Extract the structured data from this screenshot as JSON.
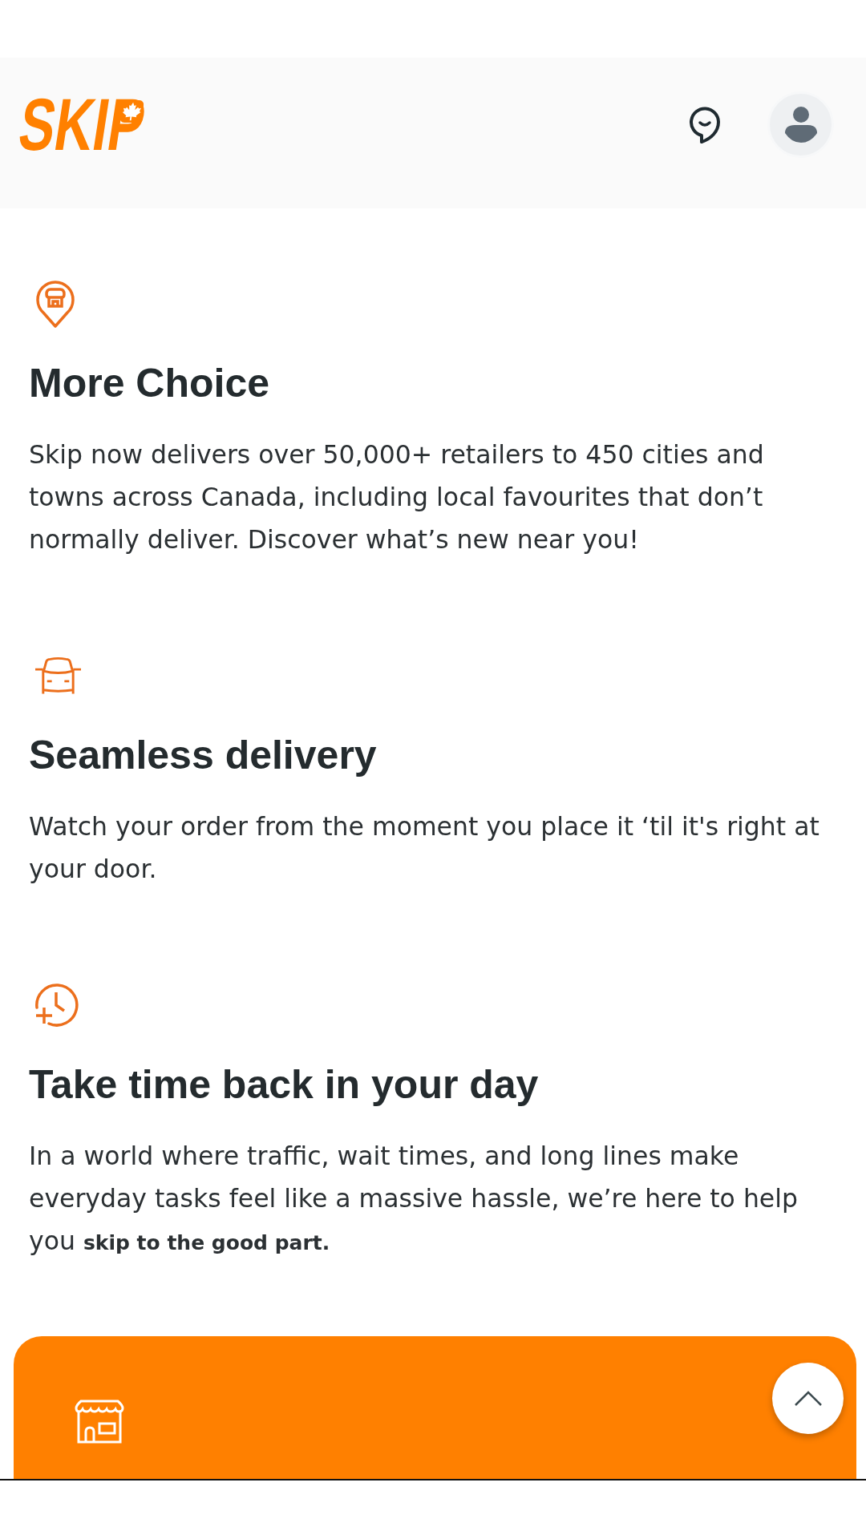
{
  "header": {
    "logo": "SKIP"
  },
  "features": [
    {
      "kind": "store-pin",
      "title": "More Choice",
      "text": "Skip now delivers over 50,000+ retailers to 450 cities and towns across Canada, including local favourites that don’t normally deliver. Discover what’s new near you!"
    },
    {
      "kind": "car",
      "title": "Seamless delivery",
      "text": "Watch your order from the moment you place it ‘til it's right at your door."
    },
    {
      "kind": "clock-plus",
      "title": "Take time back in your day",
      "text": "In a world where traffic, wait times, and long lines make everyday tasks feel like a massive hassle, we’re here to help you **skip to the good part.**"
    }
  ]
}
